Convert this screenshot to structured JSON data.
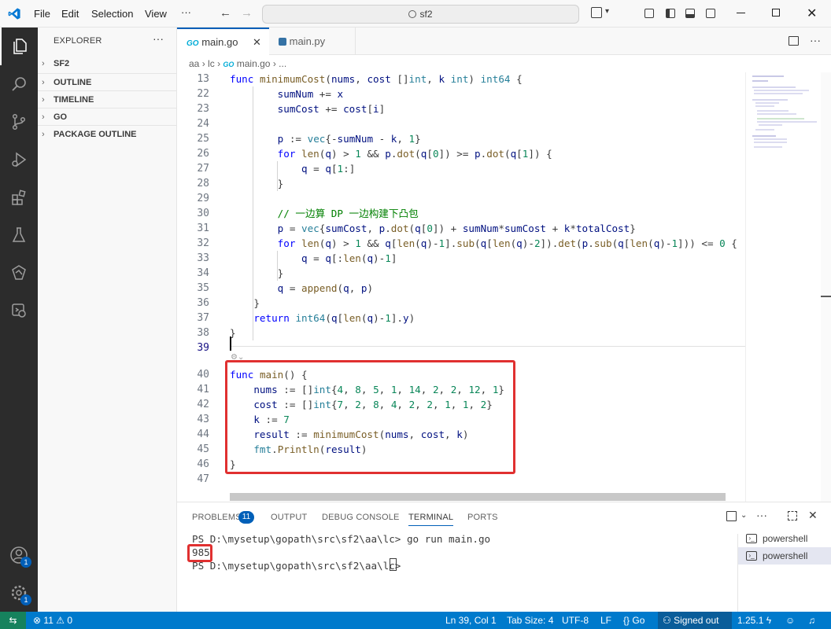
{
  "menu": {
    "file": "File",
    "edit": "Edit",
    "selection": "Selection",
    "view": "View",
    "more": "···"
  },
  "search": {
    "text": "sf2"
  },
  "sidebar": {
    "title": "EXPLORER",
    "sections": [
      "SF2",
      "OUTLINE",
      "TIMELINE",
      "GO",
      "PACKAGE OUTLINE"
    ]
  },
  "activity_badges": {
    "accounts": "1",
    "settings": "1"
  },
  "tabs": [
    {
      "label": "main.go",
      "icon": "GO"
    },
    {
      "label": "main.py",
      "icon": "python-icon"
    }
  ],
  "breadcrumb": {
    "p1": "aa",
    "p2": "lc",
    "p3_icon": "GO",
    "p3": "main.go",
    "p4": "..."
  },
  "code_lines": [
    {
      "n": "13",
      "html": "<span class=\"kw\">func</span> <span class=\"fn\">minimumCost</span>(<span class=\"vr\">nums</span>, <span class=\"vr\">cost</span> []<span class=\"ty\">int</span>, <span class=\"vr\">k</span> <span class=\"ty\">int</span>) <span class=\"ty\">int64</span> {"
    },
    {
      "n": "22",
      "html": "        <span class=\"vr\">sumNum</span> += <span class=\"vr\">x</span>"
    },
    {
      "n": "23",
      "html": "        <span class=\"vr\">sumCost</span> += <span class=\"vr\">cost</span>[<span class=\"vr\">i</span>]"
    },
    {
      "n": "24",
      "html": ""
    },
    {
      "n": "25",
      "html": "        <span class=\"vr\">p</span> := <span class=\"ty\">vec</span>{-<span class=\"vr\">sumNum</span> - <span class=\"vr\">k</span>, <span class=\"num\">1</span>}"
    },
    {
      "n": "26",
      "html": "        <span class=\"kw\">for</span> <span class=\"fn\">len</span>(<span class=\"vr\">q</span>) &gt; <span class=\"num\">1</span> &amp;&amp; <span class=\"vr\">p</span>.<span class=\"fn\">dot</span>(<span class=\"vr\">q</span>[<span class=\"num\">0</span>]) &gt;= <span class=\"vr\">p</span>.<span class=\"fn\">dot</span>(<span class=\"vr\">q</span>[<span class=\"num\">1</span>]) {"
    },
    {
      "n": "27",
      "html": "            <span class=\"vr\">q</span> = <span class=\"vr\">q</span>[<span class=\"num\">1</span>:]"
    },
    {
      "n": "28",
      "html": "        }"
    },
    {
      "n": "29",
      "html": ""
    },
    {
      "n": "30",
      "html": "        <span class=\"cm\">// 一边算 DP 一边构建下凸包</span>"
    },
    {
      "n": "31",
      "html": "        <span class=\"vr\">p</span> = <span class=\"ty\">vec</span>{<span class=\"vr\">sumCost</span>, <span class=\"vr\">p</span>.<span class=\"fn\">dot</span>(<span class=\"vr\">q</span>[<span class=\"num\">0</span>]) + <span class=\"vr\">sumNum</span>*<span class=\"vr\">sumCost</span> + <span class=\"vr\">k</span>*<span class=\"vr\">totalCost</span>}"
    },
    {
      "n": "32",
      "html": "        <span class=\"kw\">for</span> <span class=\"fn\">len</span>(<span class=\"vr\">q</span>) &gt; <span class=\"num\">1</span> &amp;&amp; <span class=\"vr\">q</span>[<span class=\"fn\">len</span>(<span class=\"vr\">q</span>)-<span class=\"num\">1</span>].<span class=\"fn\">sub</span>(<span class=\"vr\">q</span>[<span class=\"fn\">len</span>(<span class=\"vr\">q</span>)-<span class=\"num\">2</span>]).<span class=\"fn\">det</span>(<span class=\"vr\">p</span>.<span class=\"fn\">sub</span>(<span class=\"vr\">q</span>[<span class=\"fn\">len</span>(<span class=\"vr\">q</span>)-<span class=\"num\">1</span>])) &lt;= <span class=\"num\">0</span> {"
    },
    {
      "n": "33",
      "html": "            <span class=\"vr\">q</span> = <span class=\"vr\">q</span>[:<span class=\"fn\">len</span>(<span class=\"vr\">q</span>)-<span class=\"num\">1</span>]"
    },
    {
      "n": "34",
      "html": "        }"
    },
    {
      "n": "35",
      "html": "        <span class=\"vr\">q</span> = <span class=\"fn\">append</span>(<span class=\"vr\">q</span>, <span class=\"vr\">p</span>)"
    },
    {
      "n": "36",
      "html": "    }"
    },
    {
      "n": "37",
      "html": "    <span class=\"kw\">return</span> <span class=\"ty\">int64</span>(<span class=\"vr\">q</span>[<span class=\"fn\">len</span>(<span class=\"vr\">q</span>)-<span class=\"num\">1</span>].<span class=\"vr\">y</span>)"
    },
    {
      "n": "38",
      "html": "}"
    },
    {
      "n": "39",
      "html": ""
    },
    {
      "n": "40",
      "html": "<span class=\"kw\">func</span> <span class=\"fn\">main</span>() {"
    },
    {
      "n": "41",
      "html": "    <span class=\"vr\">nums</span> := []<span class=\"ty\">int</span>{<span class=\"num\">4</span>, <span class=\"num\">8</span>, <span class=\"num\">5</span>, <span class=\"num\">1</span>, <span class=\"num\">14</span>, <span class=\"num\">2</span>, <span class=\"num\">2</span>, <span class=\"num\">12</span>, <span class=\"num\">1</span>}"
    },
    {
      "n": "42",
      "html": "    <span class=\"vr\">cost</span> := []<span class=\"ty\">int</span>{<span class=\"num\">7</span>, <span class=\"num\">2</span>, <span class=\"num\">8</span>, <span class=\"num\">4</span>, <span class=\"num\">2</span>, <span class=\"num\">2</span>, <span class=\"num\">1</span>, <span class=\"num\">1</span>, <span class=\"num\">2</span>}"
    },
    {
      "n": "43",
      "html": "    <span class=\"vr\">k</span> := <span class=\"num\">7</span>"
    },
    {
      "n": "44",
      "html": "    <span class=\"vr\">result</span> := <span class=\"fn\">minimumCost</span>(<span class=\"vr\">nums</span>, <span class=\"vr\">cost</span>, <span class=\"vr\">k</span>)"
    },
    {
      "n": "45",
      "html": "    <span class=\"ty\">fmt</span>.<span class=\"fn\">Println</span>(<span class=\"vr\">result</span>)"
    },
    {
      "n": "46",
      "html": "}"
    },
    {
      "n": "47",
      "html": ""
    }
  ],
  "panel": {
    "tabs": [
      "PROBLEMS",
      "OUTPUT",
      "DEBUG CONSOLE",
      "TERMINAL",
      "PORTS"
    ],
    "problems_badge": "11",
    "terminal_lines": [
      "PS D:\\mysetup\\gopath\\src\\sf2\\aa\\lc> go run main.go",
      "985",
      "PS D:\\mysetup\\gopath\\src\\sf2\\aa\\lc> "
    ],
    "terminals": [
      "powershell",
      "powershell"
    ]
  },
  "status": {
    "errors": "11",
    "warnings": "0",
    "position": "Ln 39, Col 1",
    "tab_size": "Tab Size: 4",
    "encoding": "UTF-8",
    "eol": "LF",
    "language": "Go",
    "account": "Signed out",
    "go_version": "1.25.1"
  },
  "colors": {
    "accent": "#005fb8",
    "statusbar": "#007acc",
    "highlight": "#e03030"
  }
}
